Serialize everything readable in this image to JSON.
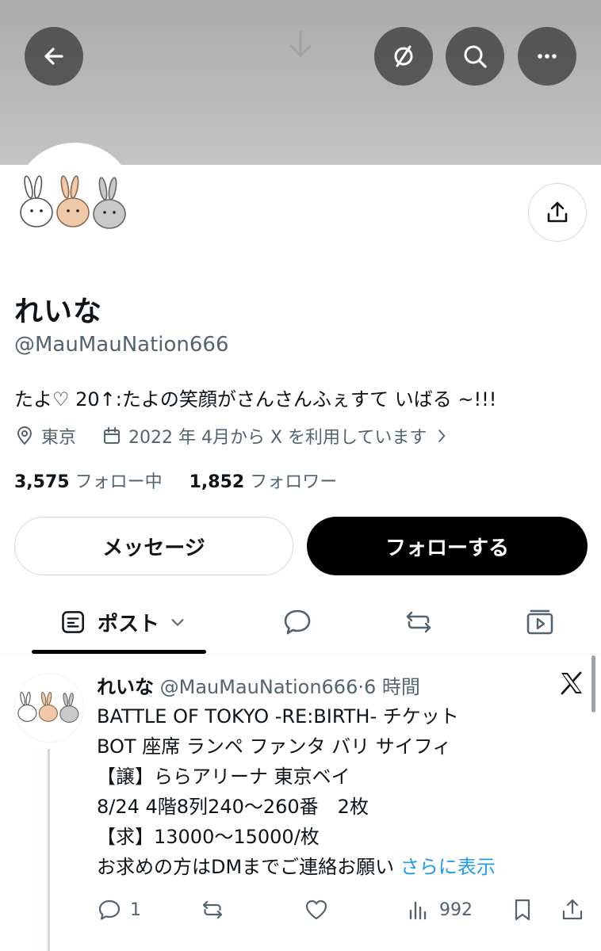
{
  "header": {
    "back_icon": "arrow-left-icon",
    "mute_icon": "slashed-circle-icon",
    "search_icon": "search-icon",
    "more_icon": "more-horizontal-icon"
  },
  "profile": {
    "display_name": "れいな",
    "handle": "@MauMauNation666",
    "bio": "たよ♡ 20↑:たよの笑顔がさんさんふぇすて いばる ~!!!",
    "location": "東京",
    "joined": "2022 年 4月から X を利用しています",
    "following_count": "3,575",
    "following_label": "フォロー中",
    "followers_count": "1,852",
    "followers_label": "フォロワー"
  },
  "buttons": {
    "message": "メッセージ",
    "follow": "フォローする"
  },
  "tabs": {
    "posts_label": "ポスト"
  },
  "post": {
    "author": "れいな",
    "handle": "@MauMauNation666",
    "separator": "·",
    "time": "6 時間",
    "lines": [
      "BATTLE OF TOKYO -RE:BIRTH- チケット",
      "BOT 座席 ランペ ファンタ バリ サイフィ",
      "【譲】ららアリーナ 東京ベイ",
      "8/24 4階8列240〜260番　2枚",
      "【求】13000〜15000/枚",
      "お求めの方はDMまでご連絡お願い"
    ],
    "show_more": "さらに表示",
    "reply_count": "1",
    "view_count": "992"
  },
  "colors": {
    "accent": "#1d9bf0",
    "text": "#0f1419",
    "muted": "#536471",
    "follow_bg": "#000000"
  }
}
